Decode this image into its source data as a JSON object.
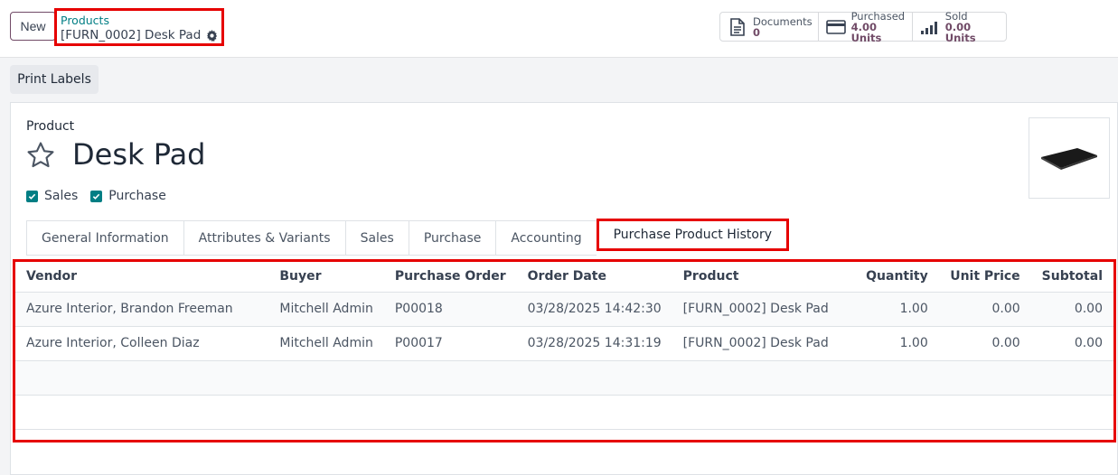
{
  "header": {
    "new_label": "New",
    "breadcrumb_parent": "Products",
    "breadcrumb_current": "[FURN_0002] Desk Pad"
  },
  "smart_buttons": [
    {
      "label": "Documents",
      "value": "0",
      "icon": "document-icon"
    },
    {
      "label": "Purchased",
      "value": "4.00 Units",
      "icon": "credit-card-icon"
    },
    {
      "label": "Sold",
      "value": "0.00 Units",
      "icon": "signal-bars-icon"
    }
  ],
  "toolbar": {
    "print_labels": "Print Labels"
  },
  "product": {
    "label": "Product",
    "name": "Desk Pad",
    "sales_label": "Sales",
    "purchase_label": "Purchase"
  },
  "tabs": [
    {
      "label": "General Information"
    },
    {
      "label": "Attributes & Variants"
    },
    {
      "label": "Sales"
    },
    {
      "label": "Purchase"
    },
    {
      "label": "Accounting"
    },
    {
      "label": "Purchase Product History"
    }
  ],
  "history_table": {
    "columns": [
      "Vendor",
      "Buyer",
      "Purchase Order",
      "Order Date",
      "Product",
      "Quantity",
      "Unit Price",
      "Subtotal"
    ],
    "rows": [
      [
        "Azure Interior, Brandon Freeman",
        "Mitchell Admin",
        "P00018",
        "03/28/2025 14:42:30",
        "[FURN_0002] Desk Pad",
        "1.00",
        "0.00",
        "0.00"
      ],
      [
        "Azure Interior, Colleen Diaz",
        "Mitchell Admin",
        "P00017",
        "03/28/2025 14:31:19",
        "[FURN_0002] Desk Pad",
        "1.00",
        "0.00",
        "0.00"
      ]
    ]
  },
  "colors": {
    "accent": "#714b67",
    "link": "#017e84",
    "highlight": "#e60000"
  }
}
